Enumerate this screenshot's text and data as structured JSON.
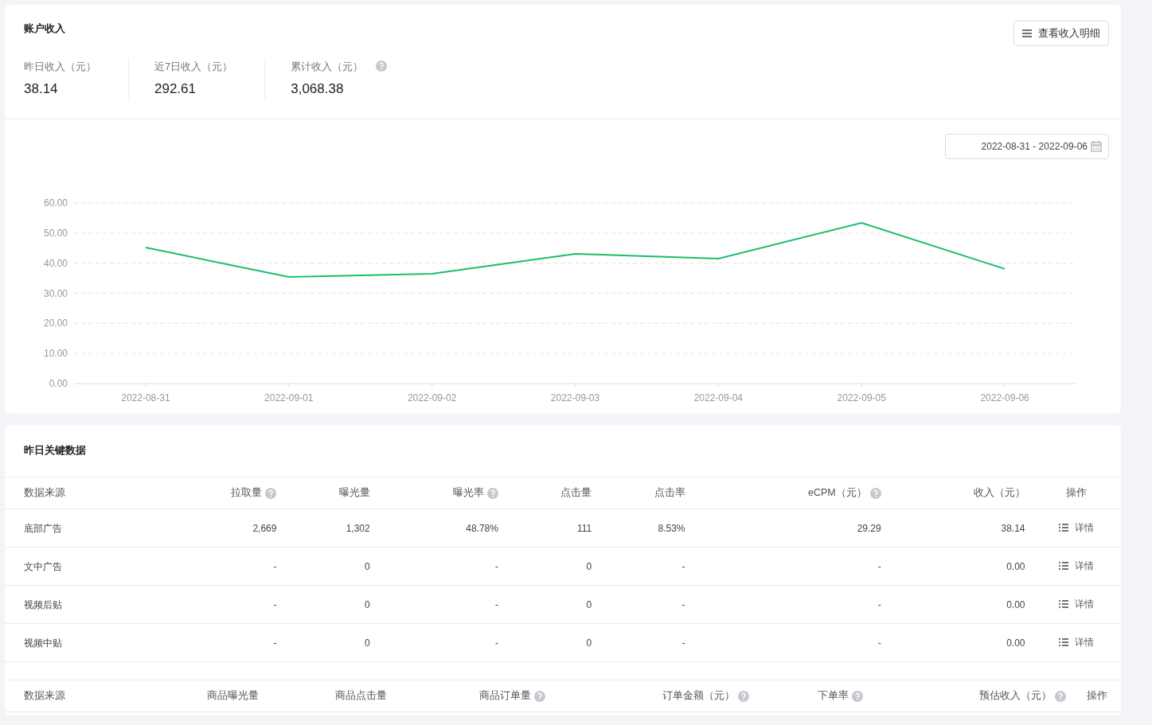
{
  "income": {
    "title": "账户收入",
    "detail_button": "查看收入明细",
    "stats": [
      {
        "label": "昨日收入（元）",
        "value": "38.14",
        "help": false
      },
      {
        "label": "近7日收入（元）",
        "value": "292.61",
        "help": false
      },
      {
        "label": "累计收入（元）",
        "value": "3,068.38",
        "help": true
      }
    ],
    "date_range": "2022-08-31 - 2022-09-06",
    "chart_data": {
      "type": "line",
      "categories": [
        "2022-08-31",
        "2022-09-01",
        "2022-09-02",
        "2022-09-03",
        "2022-09-04",
        "2022-09-05",
        "2022-09-06"
      ],
      "series": [
        {
          "color": "#19be6b",
          "values": [
            45.2,
            35.4,
            36.5,
            43.1,
            41.5,
            53.4,
            38.1
          ]
        }
      ],
      "grid": true,
      "ylim": [
        0,
        60
      ],
      "yticks": [
        {
          "value": 0,
          "label": "0.00"
        },
        {
          "value": 10,
          "label": "10.00"
        },
        {
          "value": 20,
          "label": "20.00"
        },
        {
          "value": 30,
          "label": "30.00"
        },
        {
          "value": 40,
          "label": "40.00"
        },
        {
          "value": 50,
          "label": "50.00"
        },
        {
          "value": 60,
          "label": "60.00"
        }
      ]
    }
  },
  "key_data": {
    "title": "昨日关键数据",
    "ad_table": {
      "columns": [
        {
          "label": "数据来源",
          "help": false
        },
        {
          "label": "拉取量",
          "help": true
        },
        {
          "label": "曝光量",
          "help": false
        },
        {
          "label": "曝光率",
          "help": true
        },
        {
          "label": "点击量",
          "help": false
        },
        {
          "label": "点击率",
          "help": false
        },
        {
          "label": "eCPM（元）",
          "help": true
        },
        {
          "label": "收入（元）",
          "help": false
        },
        {
          "label": "操作",
          "help": false
        }
      ],
      "rows": [
        [
          "底部广告",
          "2,669",
          "1,302",
          "48.78%",
          "111",
          "8.53%",
          "29.29",
          "38.14",
          "详情"
        ],
        [
          "文中广告",
          "-",
          "0",
          "-",
          "0",
          "-",
          "-",
          "0.00",
          "详情"
        ],
        [
          "视频后贴",
          "-",
          "0",
          "-",
          "0",
          "-",
          "-",
          "0.00",
          "详情"
        ],
        [
          "视频中贴",
          "-",
          "0",
          "-",
          "0",
          "-",
          "-",
          "0.00",
          "详情"
        ]
      ]
    },
    "goods_table": {
      "columns": [
        {
          "label": "数据来源",
          "help": false
        },
        {
          "label": "商品曝光量",
          "help": false
        },
        {
          "label": "商品点击量",
          "help": false
        },
        {
          "label": "商品订单量",
          "help": true
        },
        {
          "label": "订单金额（元）",
          "help": true
        },
        {
          "label": "下单率",
          "help": true
        },
        {
          "label": "预估收入（元）",
          "help": true
        },
        {
          "label": "操作",
          "help": false
        }
      ]
    }
  }
}
